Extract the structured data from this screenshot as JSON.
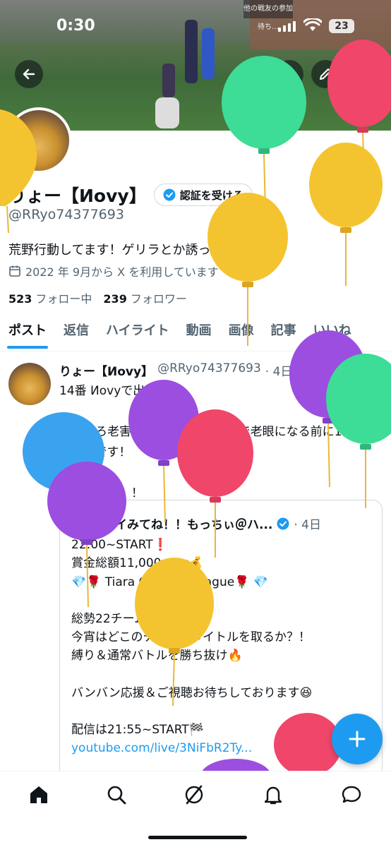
{
  "status_bar": {
    "time": "0:30",
    "battery": "23"
  },
  "banner": {
    "overlay_text": "他の戦友の参加待ち…"
  },
  "profile": {
    "display_name": "りょー【Иovy】",
    "verify_label": "認証を受ける",
    "handle": "@RRyo74377693",
    "bio": "荒野行動してます！ゲリラとか誘ってください。",
    "joined": "2022 年 9月から X を利用しています",
    "following_count": "523",
    "following_label": "フォロー中",
    "followers_count": "239",
    "followers_label": "フォロワー"
  },
  "tabs": [
    {
      "label": "ポスト",
      "active": true
    },
    {
      "label": "返信"
    },
    {
      "label": "ハイライト"
    },
    {
      "label": "動画"
    },
    {
      "label": "画像"
    },
    {
      "label": "記事"
    },
    {
      "label": "いいね"
    }
  ],
  "post": {
    "name": "りょー【Иovy】",
    "handle": "@RRyo74377693",
    "time": "· 4日",
    "lines": [
      "14番 Иovyで出ます！",
      "",
      "そろそろ老害の域に入ってきたので老眼になる前に1キルはしたいです！",
      "",
      "頑張ります！！"
    ],
    "quote": {
      "name": "固ツイみてね！！もっちぃ＠ハ...",
      "time": "· 4日",
      "lines": [
        "22:00~START❗",
        "賞金総額11,000over💰",
        "💎🌹 Tiara OneDay  League🌹 💎",
        "",
        "総勢22チーム🔥",
        "今宵はどこのチームがタイトルを取るか？！",
        "縛り＆通常バトルを勝ち抜け🔥",
        "",
        "バンバン応援＆ご視聴お待ちしております😆",
        "",
        "配信は21:55~START🏁"
      ],
      "link": "youtube.com/live/3NiFbR2Ty..."
    }
  },
  "colors": {
    "accent": "#1d9bf0",
    "text": "#0f1419",
    "muted": "#536471"
  },
  "icons": [
    "back-arrow-icon",
    "search-icon",
    "edit-icon",
    "share-icon",
    "calendar-icon",
    "verified-badge-icon",
    "grok-icon",
    "home-icon",
    "explore-icon",
    "grok-nav-icon",
    "bell-icon",
    "messages-icon",
    "plus-icon"
  ]
}
